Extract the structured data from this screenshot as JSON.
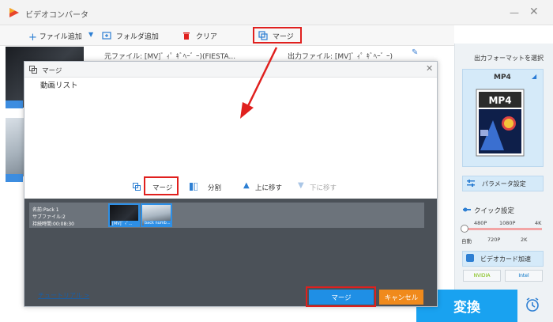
{
  "app": {
    "title": "ビデオコンバータ"
  },
  "toolbar": {
    "add_file": "ファイル追加",
    "add_folder": "フォルダ追加",
    "clear": "クリア",
    "merge": "マージ"
  },
  "file_bar": {
    "source": "元ファイル: [MV]ﾞ ｨﾟ ｷﾞﾍｰﾞ ｰ)(FIESTA...",
    "output": "出力ファイル: [MV]ﾞ ｨﾟ ｷﾞﾍｰﾞ ｰ)"
  },
  "dialog": {
    "title": "マージ",
    "list_label": "動画リスト",
    "actions": {
      "merge": "マージ",
      "split": "分割",
      "move_up": "上に移す",
      "move_down": "下に移す"
    },
    "pack": {
      "name": "名前:Pack 1",
      "subfiles": "サブファイル:2",
      "duration": "持続時間:00:08:30",
      "clip1_caption": "[MV]ﾞ ｨﾟ...",
      "clip2_caption": "back numb..."
    },
    "tutorial": "チュートリアル >",
    "merge_button": "マージ",
    "cancel_button": "キャンセル"
  },
  "right_panel": {
    "output_format_label": "出力フォーマットを選択",
    "format": "MP4",
    "format_icon_text": "MP4",
    "param_settings": "パラメータ設定",
    "quick_settings": "クイック設定",
    "res_top": [
      "480P",
      "1080P",
      "4K"
    ],
    "res_bottom": [
      "自動",
      "720P",
      "2K"
    ],
    "gpu_accel": "ビデオカード加速",
    "brands": [
      "NVIDIA",
      "Intel"
    ],
    "convert_button": "変換"
  },
  "colors": {
    "accent": "#1f8fe5",
    "highlight": "#e0201e",
    "cancel": "#f08a1c",
    "convert": "#19a2f0"
  }
}
